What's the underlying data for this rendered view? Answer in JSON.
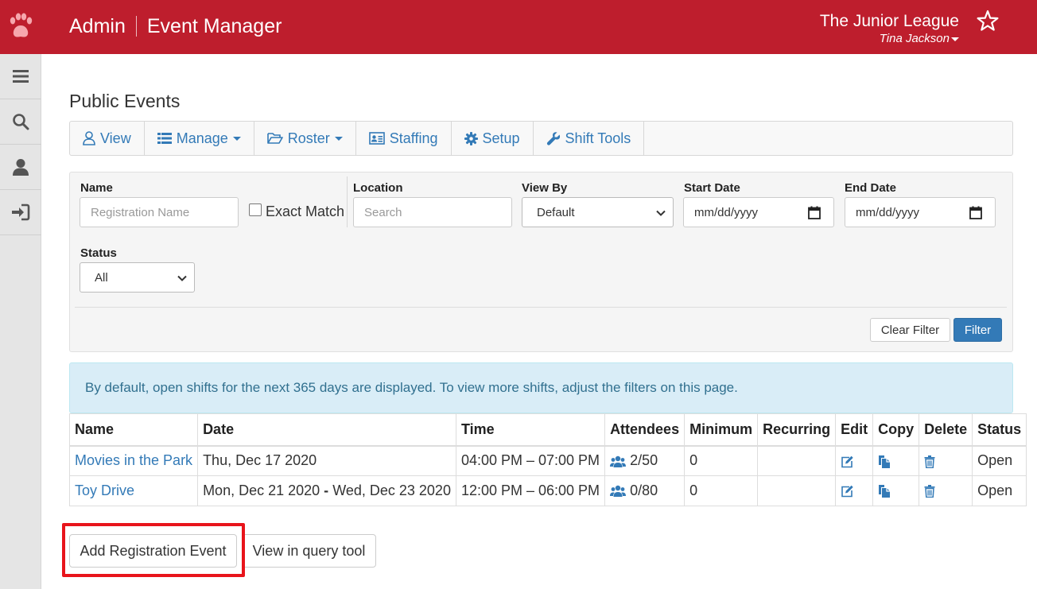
{
  "header": {
    "admin_label": "Admin",
    "app_title": "Event Manager",
    "org_name": "The Junior League",
    "user_name": "Tina Jackson",
    "brand_color": "#be1e2d",
    "logo_icon": "paw-icon",
    "favorite_icon": "star-icon"
  },
  "sidebar": {
    "items": [
      {
        "name": "menu-icon"
      },
      {
        "name": "search-icon"
      },
      {
        "name": "user-icon"
      },
      {
        "name": "sign-in-icon"
      }
    ]
  },
  "page": {
    "title": "Public Events"
  },
  "tabs": [
    {
      "label": "View",
      "icon": "user-outline-icon"
    },
    {
      "label": "Manage",
      "icon": "list-icon",
      "dropdown": true
    },
    {
      "label": "Roster",
      "icon": "folder-open-icon",
      "dropdown": true
    },
    {
      "label": "Staffing",
      "icon": "id-card-icon"
    },
    {
      "label": "Setup",
      "icon": "gear-icon"
    },
    {
      "label": "Shift Tools",
      "icon": "wrench-icon"
    }
  ],
  "filters": {
    "name_label": "Name",
    "name_placeholder": "Registration Name",
    "exact_match_label": "Exact Match",
    "exact_match_checked": false,
    "location_label": "Location",
    "location_placeholder": "Search",
    "view_by_label": "View By",
    "view_by_value": "Default",
    "start_date_label": "Start Date",
    "start_date_value": "mm/dd/yyyy",
    "end_date_label": "End Date",
    "end_date_value": "mm/dd/yyyy",
    "status_label": "Status",
    "status_value": "All",
    "clear_label": "Clear Filter",
    "filter_label": "Filter"
  },
  "info_message": "By default, open shifts for the next 365 days are displayed. To view more shifts, adjust the filters on this page.",
  "table": {
    "headers": [
      "Name",
      "Date",
      "Time",
      "Attendees",
      "Minimum",
      "Recurring",
      "Edit",
      "Copy",
      "Delete",
      "Status"
    ],
    "rows": [
      {
        "name": "Movies in the Park",
        "date": "Thu, Dec 17 2020",
        "time": "04:00 PM – 07:00 PM",
        "attendees": "2/50",
        "minimum": "0",
        "recurring": "",
        "status": "Open"
      },
      {
        "name": "Toy Drive",
        "date_start": "Mon, Dec 21 2020",
        "date_sep": "-",
        "date_end": "Wed, Dec 23 2020",
        "time": "12:00 PM – 06:00 PM",
        "attendees": "0/80",
        "minimum": "0",
        "recurring": "",
        "status": "Open"
      }
    ]
  },
  "actions": {
    "add_label": "Add Registration Event",
    "query_label": "View in query tool",
    "highlight_color": "#e8141b"
  }
}
